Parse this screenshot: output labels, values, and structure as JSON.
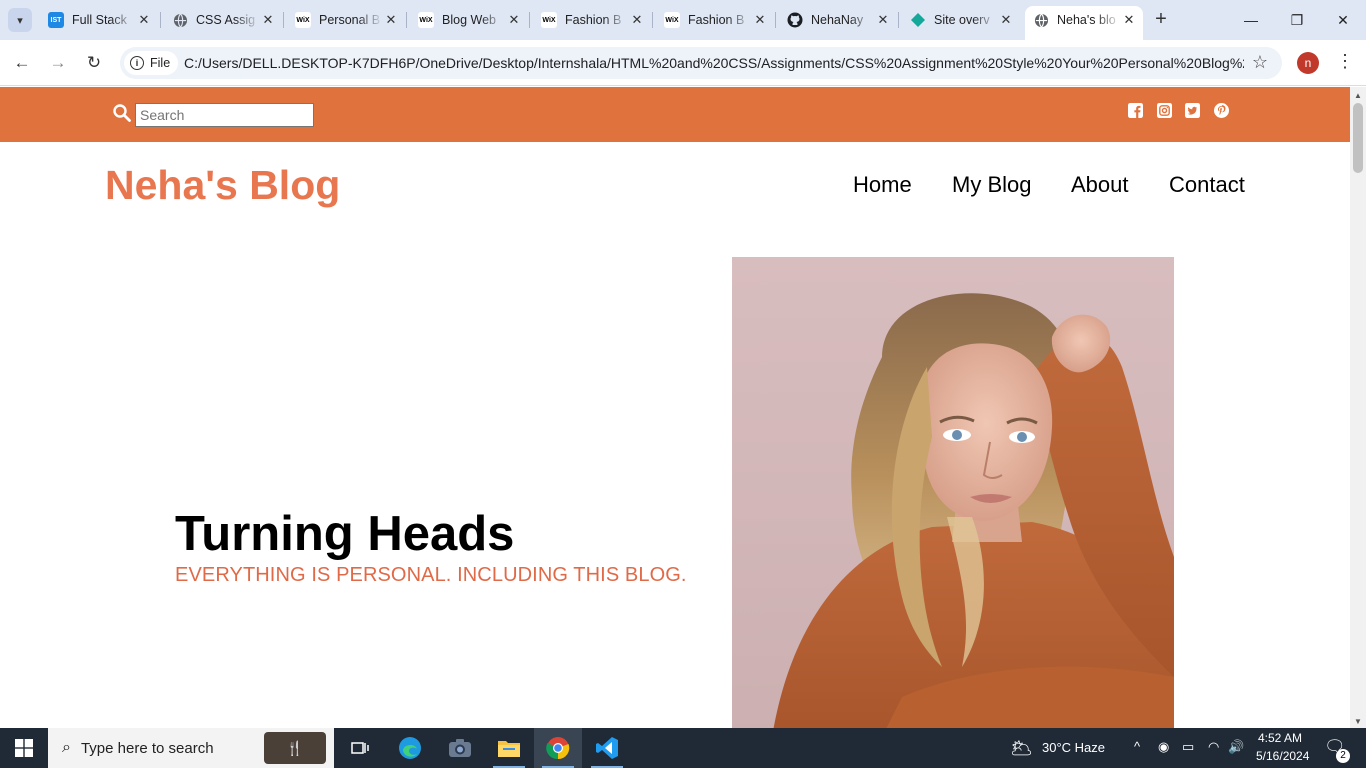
{
  "browser": {
    "tabs": [
      {
        "title": "Full Stack",
        "favicon": "ist-icon"
      },
      {
        "title": "CSS Assig",
        "favicon": "globe-icon"
      },
      {
        "title": "Personal B",
        "favicon": "wix-icon"
      },
      {
        "title": "Blog Web",
        "favicon": "wix-icon"
      },
      {
        "title": "Fashion B",
        "favicon": "wix-icon"
      },
      {
        "title": "Fashion B",
        "favicon": "wix-icon"
      },
      {
        "title": "NehaNay",
        "favicon": "github-icon"
      },
      {
        "title": "Site overv",
        "favicon": "diamond-icon"
      },
      {
        "title": "Neha's blo",
        "favicon": "globe-icon",
        "active": true
      }
    ],
    "address": {
      "chip_label": "File",
      "url": "C:/Users/DELL.DESKTOP-K7DFH6P/OneDrive/Desktop/Internshala/HTML%20and%20CSS/Assignments/CSS%20Assignment%20Style%20Your%20Personal%20Blog%20We..."
    },
    "profile_initial": "n"
  },
  "page": {
    "search": {
      "placeholder": "Search"
    },
    "social_icons": [
      "facebook-icon",
      "instagram-icon",
      "twitter-icon",
      "pinterest-icon"
    ],
    "brand": "Neha's Blog",
    "nav": [
      "Home",
      "My Blog",
      "About",
      "Contact"
    ],
    "hero": {
      "title": "Turning Heads",
      "subtitle": "EVERYTHING IS PERSONAL. INCLUDING THIS BLOG."
    },
    "colors": {
      "accent": "#e0733d",
      "brand": "#e8774f",
      "subtitle": "#e06a48"
    }
  },
  "taskbar": {
    "search_placeholder": "Type here to search",
    "weather": "30°C  Haze",
    "time": "4:52 AM",
    "date": "5/16/2024",
    "notifications": "2"
  }
}
